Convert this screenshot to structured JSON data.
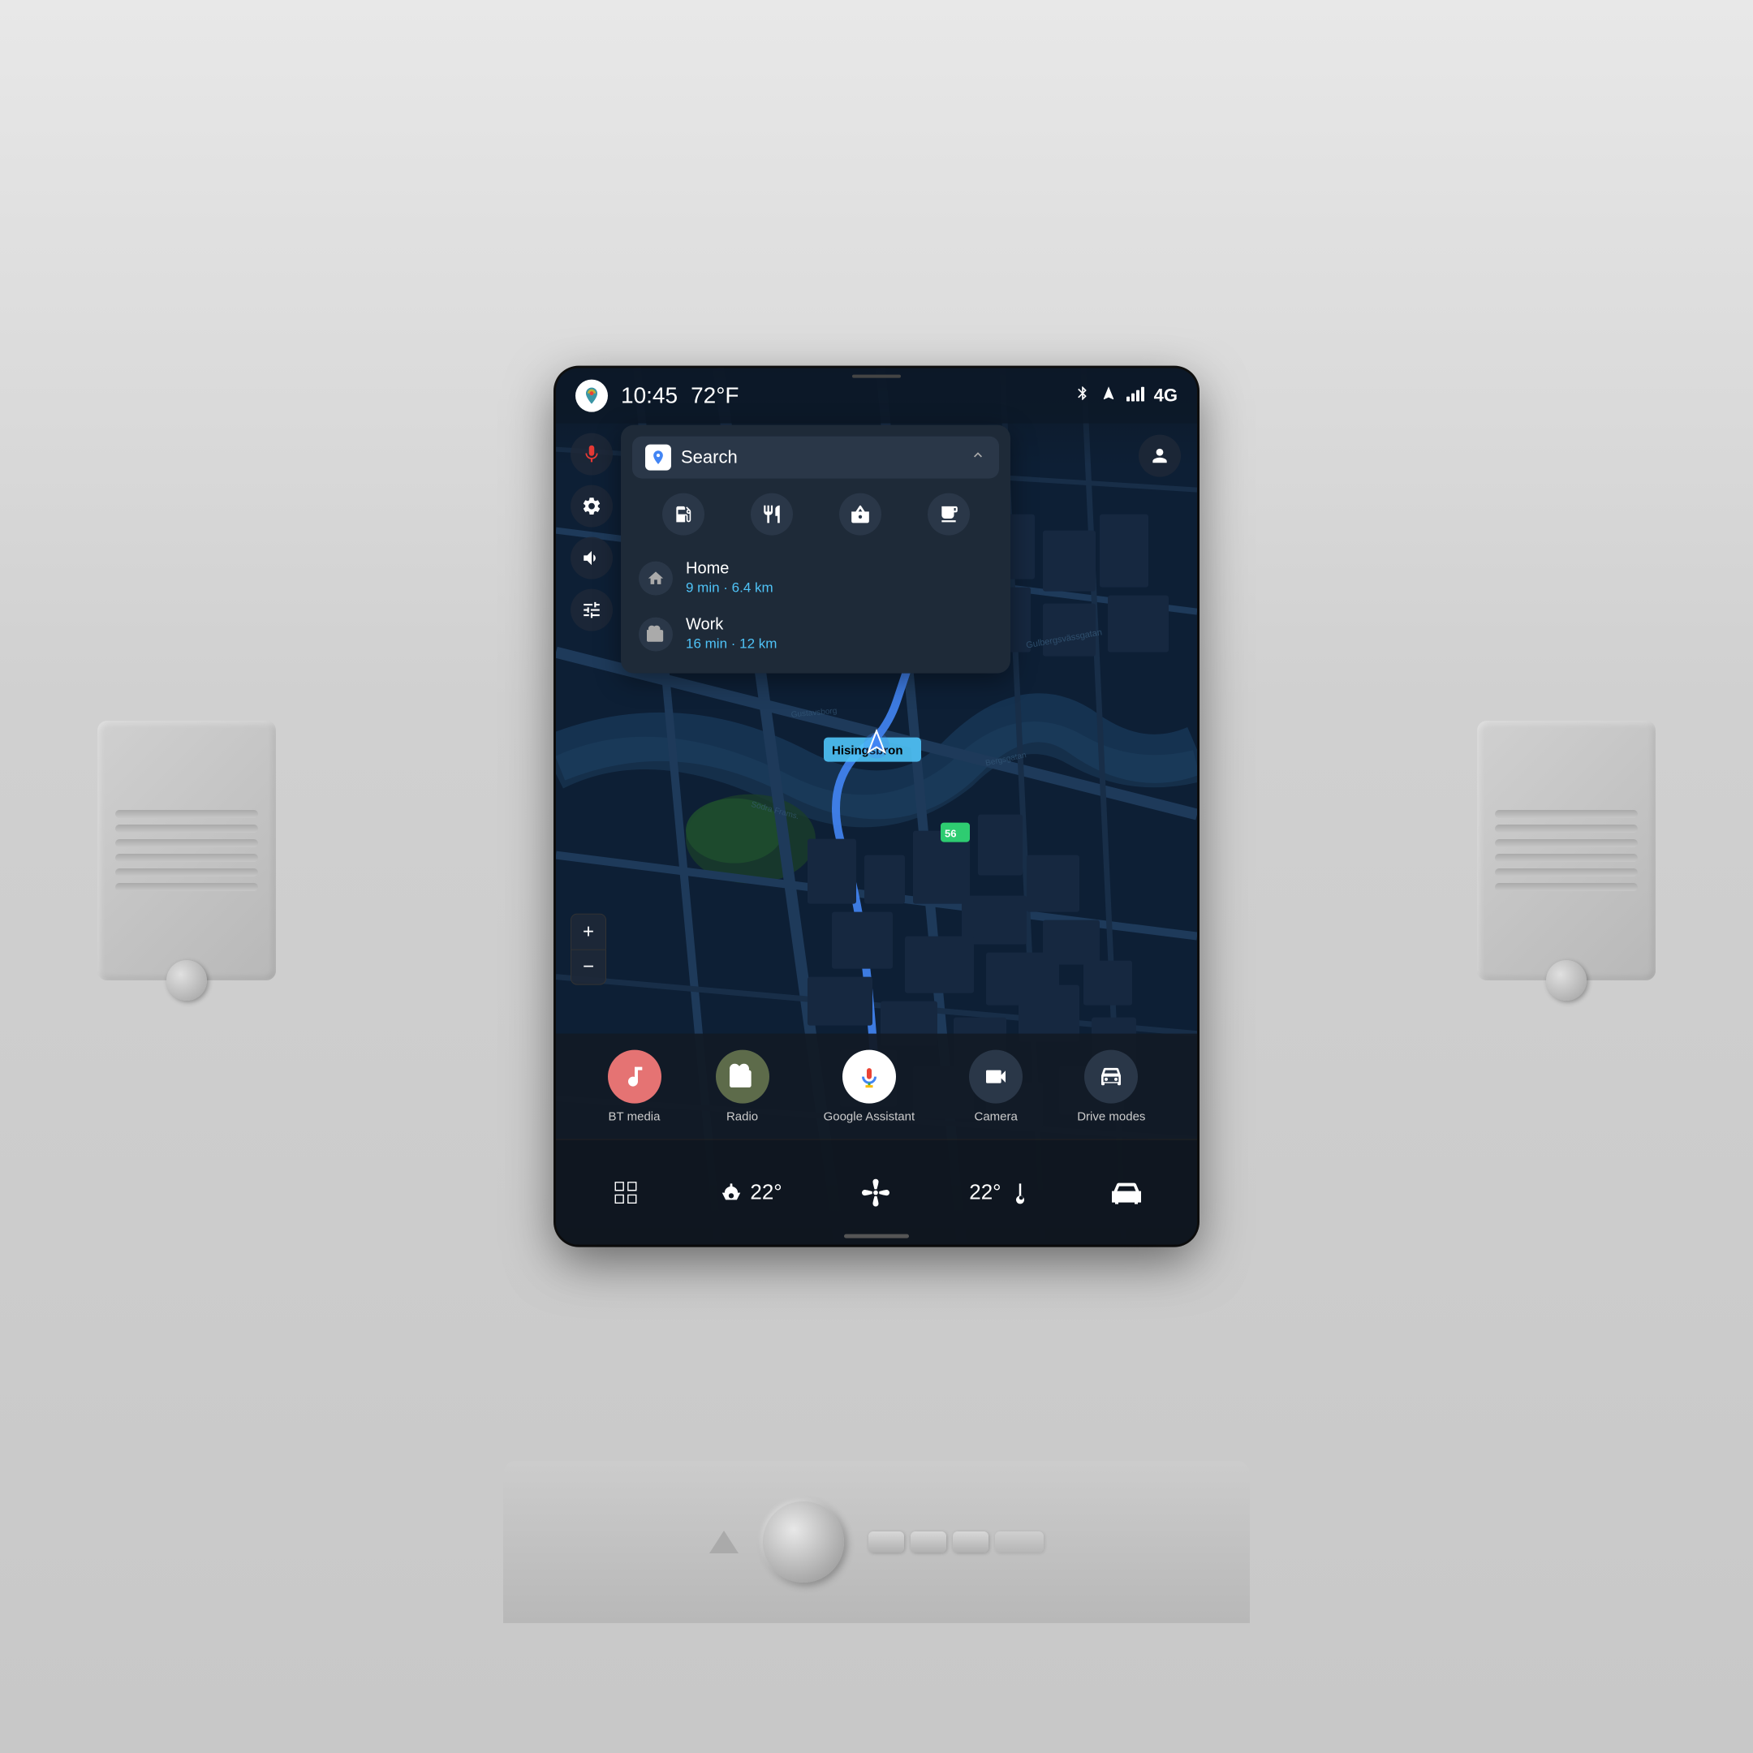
{
  "statusBar": {
    "appIcon": "A",
    "time": "10:45",
    "temperature": "72°F",
    "bluetoothIcon": "BT",
    "locationIcon": "LOC",
    "signalIcon": "SIG",
    "networkLabel": "4G"
  },
  "searchPanel": {
    "searchLabel": "Search",
    "chevronIcon": "chevron-up",
    "categories": [
      {
        "icon": "⛽",
        "label": "fuel",
        "name": "fuel-station-cat"
      },
      {
        "icon": "🍴",
        "label": "restaurant",
        "name": "restaurant-cat"
      },
      {
        "icon": "🛒",
        "label": "shopping",
        "name": "shopping-cat"
      },
      {
        "icon": "💻",
        "label": "services",
        "name": "services-cat"
      }
    ],
    "destinations": [
      {
        "name": "Home",
        "detail": "9 min · 6.4 km",
        "icon": "home"
      },
      {
        "name": "Work",
        "detail": "16 min · 12 km",
        "icon": "work"
      }
    ]
  },
  "leftSidebar": {
    "micBtn": "🎤",
    "settingsBtn": "⚙",
    "volumeBtn": "🔊",
    "tuneBtn": "🎛"
  },
  "map": {
    "locationLabel": "Hisingsbron",
    "zoomIn": "+",
    "zoomOut": "−"
  },
  "bottomApps": [
    {
      "label": "BT media",
      "iconClass": "bt-media",
      "icon": "📻"
    },
    {
      "label": "Radio",
      "iconClass": "radio",
      "icon": "📻"
    },
    {
      "label": "Google Assistant",
      "iconClass": "google-assistant",
      "icon": "🎤"
    },
    {
      "label": "Camera",
      "iconClass": "camera",
      "icon": "📹"
    },
    {
      "label": "Drive modes",
      "iconClass": "drive-modes",
      "icon": "🚗"
    }
  ],
  "climateBar": {
    "gridIcon": "⊞",
    "seatLeftTemp": "22°",
    "fanIcon": "❄",
    "tempCenter": "22°",
    "carIcon": "🚗"
  }
}
